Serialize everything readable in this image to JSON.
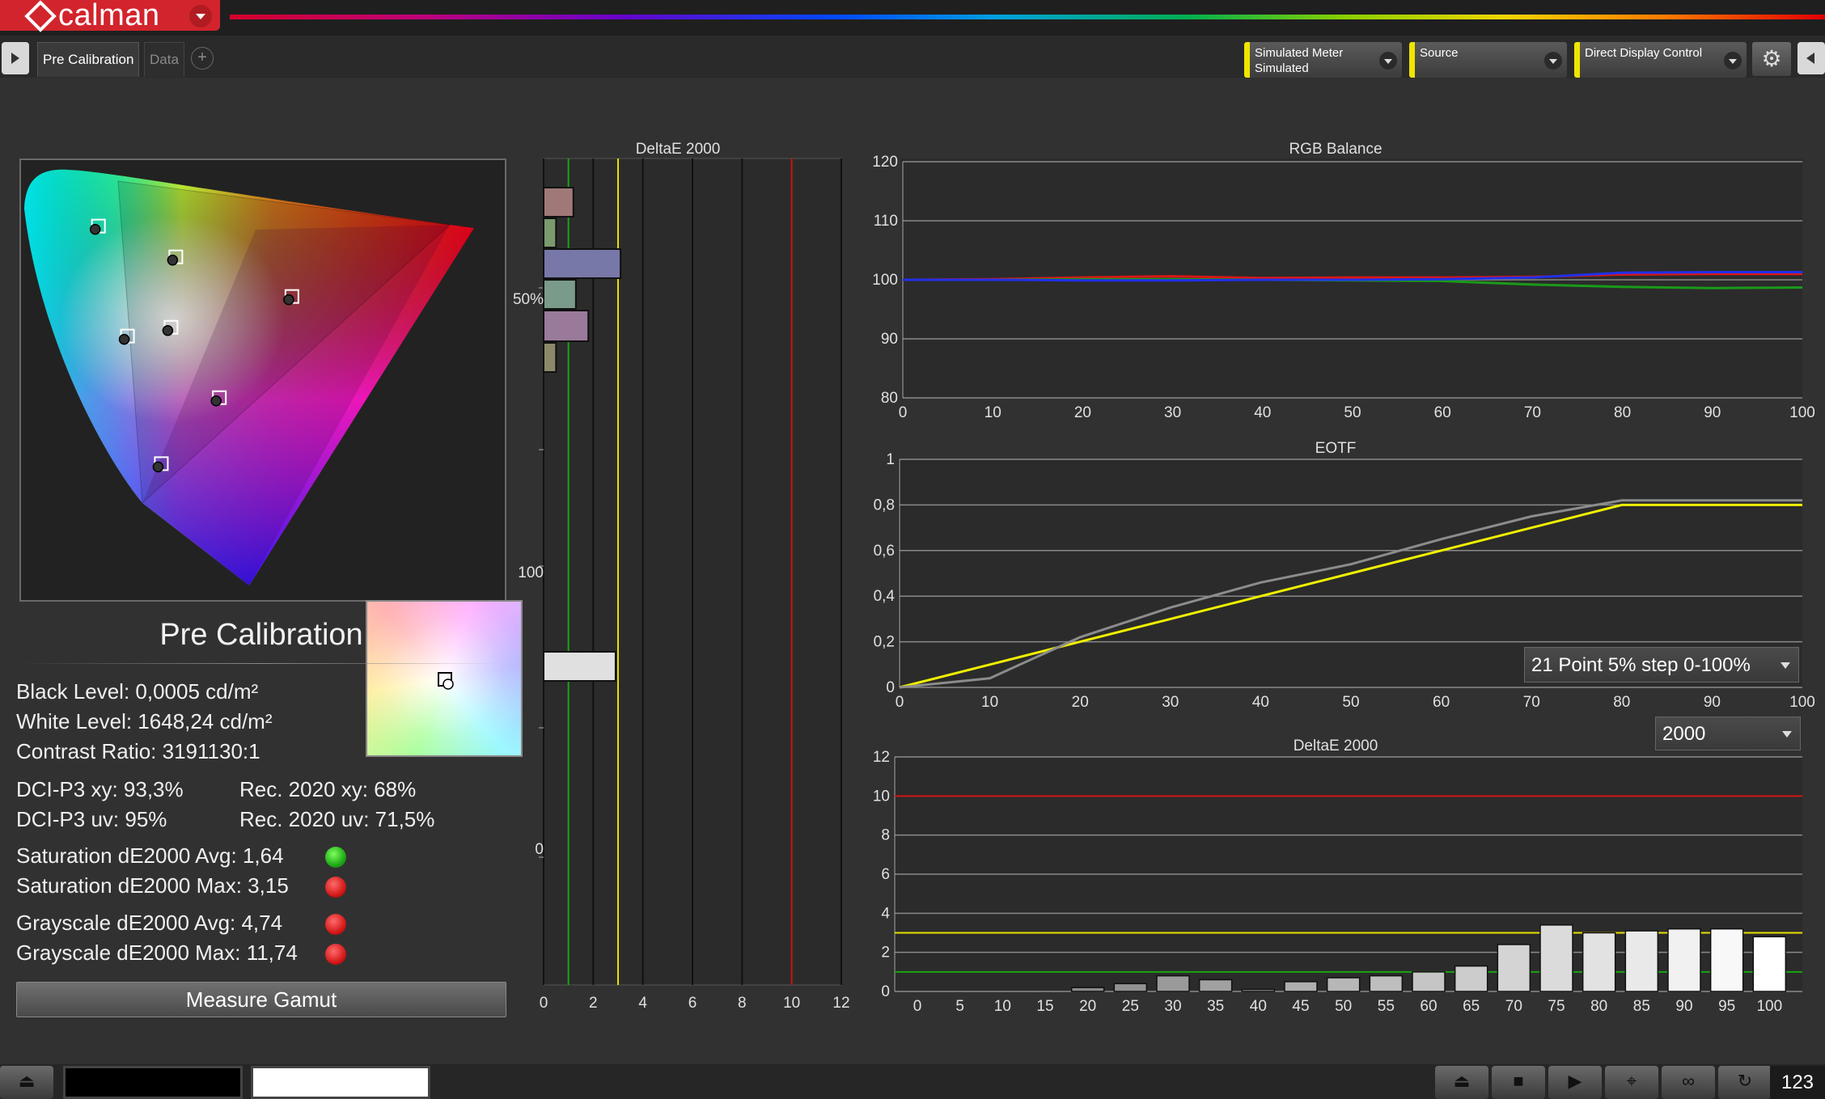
{
  "app": {
    "name": "calman"
  },
  "tabs": {
    "items": [
      "Pre Calibration",
      "Data"
    ],
    "add": "+"
  },
  "header": {
    "meter": {
      "line1": "Simulated Meter",
      "line2": "Simulated"
    },
    "source": {
      "line1": "Source"
    },
    "display": {
      "line1": "Direct Display Control"
    }
  },
  "cie": {
    "targets": [
      {
        "name": "green",
        "fx": 0.16,
        "fy": 0.15
      },
      {
        "name": "yellow",
        "fx": 0.32,
        "fy": 0.22
      },
      {
        "name": "cyan",
        "fx": 0.22,
        "fy": 0.4
      },
      {
        "name": "white",
        "fx": 0.31,
        "fy": 0.38
      },
      {
        "name": "red",
        "fx": 0.56,
        "fy": 0.31
      },
      {
        "name": "magenta",
        "fx": 0.41,
        "fy": 0.54
      },
      {
        "name": "blue-target",
        "fx": 0.29,
        "fy": 0.69
      }
    ]
  },
  "summary": {
    "title": "Pre Calibration",
    "black_level": "Black Level: 0,0005 cd/m²",
    "white_level": "White Level: 1648,24 cd/m²",
    "contrast": "Contrast Ratio: 3191130:1",
    "dci_xy": "DCI-P3 xy: 93,3%",
    "rec_xy": "Rec. 2020 xy: 68%",
    "dci_uv": "DCI-P3 uv: 95%",
    "rec_uv": "Rec. 2020 uv: 71,5%",
    "sat_avg": "Saturation dE2000 Avg: 1,64",
    "sat_max": "Saturation dE2000 Max: 3,15",
    "gray_avg": "Grayscale dE2000 Avg: 4,74",
    "gray_max": "Grayscale dE2000 Max: 11,74",
    "measure_button": "Measure Gamut"
  },
  "status_colors": {
    "sat_avg": "#1aa312",
    "sat_max": "#d01414",
    "gray_avg": "#d01414",
    "gray_max": "#d01414"
  },
  "eotf_select": "21 Point 5% step 0-100%",
  "de_select": "2000",
  "counter": "123",
  "chart_data": [
    {
      "type": "bar",
      "title": "DeltaE 2000",
      "orientation": "horizontal",
      "y_labels": [
        "50%",
        "100",
        "0"
      ],
      "x_ticks": [
        0,
        2,
        4,
        6,
        8,
        10,
        12
      ],
      "xlim": [
        0,
        12
      ],
      "thresholds": {
        "green": 1,
        "yellow": 3,
        "red": 10
      },
      "bars": [
        {
          "value": 1.2,
          "color": "#a07878"
        },
        {
          "value": 0.5,
          "color": "#7a9a6e"
        },
        {
          "value": 3.1,
          "color": "#7878a8"
        },
        {
          "value": 1.3,
          "color": "#7a9a8a"
        },
        {
          "value": 1.8,
          "color": "#9a7a9a"
        },
        {
          "value": 0.5,
          "color": "#8a8a6a"
        },
        {
          "value": 2.9,
          "color": "#e0e0e0"
        }
      ]
    },
    {
      "type": "line",
      "title": "RGB Balance",
      "x": [
        0,
        10,
        20,
        30,
        40,
        50,
        60,
        70,
        80,
        90,
        100
      ],
      "ylim": [
        80,
        120
      ],
      "y_ticks": [
        80,
        90,
        100,
        110,
        120
      ],
      "series": [
        {
          "color": "#d81818",
          "values": [
            100,
            100.1,
            100.4,
            100.6,
            100.3,
            100.4,
            100.4,
            100.5,
            100.9,
            101.0,
            101.0
          ]
        },
        {
          "color": "#1a9a1a",
          "values": [
            100,
            100.0,
            100.1,
            100.1,
            100.0,
            99.9,
            99.8,
            99.2,
            98.8,
            98.6,
            98.7
          ]
        },
        {
          "color": "#2030e8",
          "values": [
            100,
            100.0,
            99.9,
            99.9,
            100.0,
            100.0,
            100.1,
            100.4,
            101.2,
            101.3,
            101.3
          ]
        }
      ]
    },
    {
      "type": "line",
      "title": "EOTF",
      "x": [
        0,
        10,
        20,
        30,
        40,
        50,
        60,
        70,
        80,
        90,
        100
      ],
      "ylim": [
        0,
        1
      ],
      "y_tick_labels": [
        "0",
        "0,2",
        "0,4",
        "0,6",
        "0,8",
        "1"
      ],
      "series": [
        {
          "color": "#f0f000",
          "values": [
            0.0,
            0.1,
            0.2,
            0.3,
            0.4,
            0.5,
            0.6,
            0.7,
            0.8,
            0.8,
            0.8
          ]
        },
        {
          "color": "#8c8c8c",
          "values": [
            0.0,
            0.04,
            0.22,
            0.35,
            0.46,
            0.54,
            0.65,
            0.75,
            0.82,
            0.82,
            0.82
          ]
        }
      ]
    },
    {
      "type": "bar",
      "title": "DeltaE 2000",
      "categories": [
        "0",
        "5",
        "10",
        "15",
        "20",
        "25",
        "30",
        "35",
        "40",
        "45",
        "50",
        "55",
        "60",
        "65",
        "70",
        "75",
        "80",
        "85",
        "90",
        "95",
        "100"
      ],
      "values": [
        0.0,
        0.0,
        0.0,
        0.0,
        0.2,
        0.4,
        0.8,
        0.6,
        0.1,
        0.5,
        0.7,
        0.8,
        1.0,
        1.3,
        2.4,
        3.4,
        3.0,
        3.1,
        3.2,
        3.2,
        2.8
      ],
      "ylim": [
        0,
        12
      ],
      "y_ticks": [
        0,
        2,
        4,
        6,
        8,
        10,
        12
      ],
      "thresholds": {
        "green": 1,
        "yellow": 3,
        "red": 10
      }
    }
  ]
}
